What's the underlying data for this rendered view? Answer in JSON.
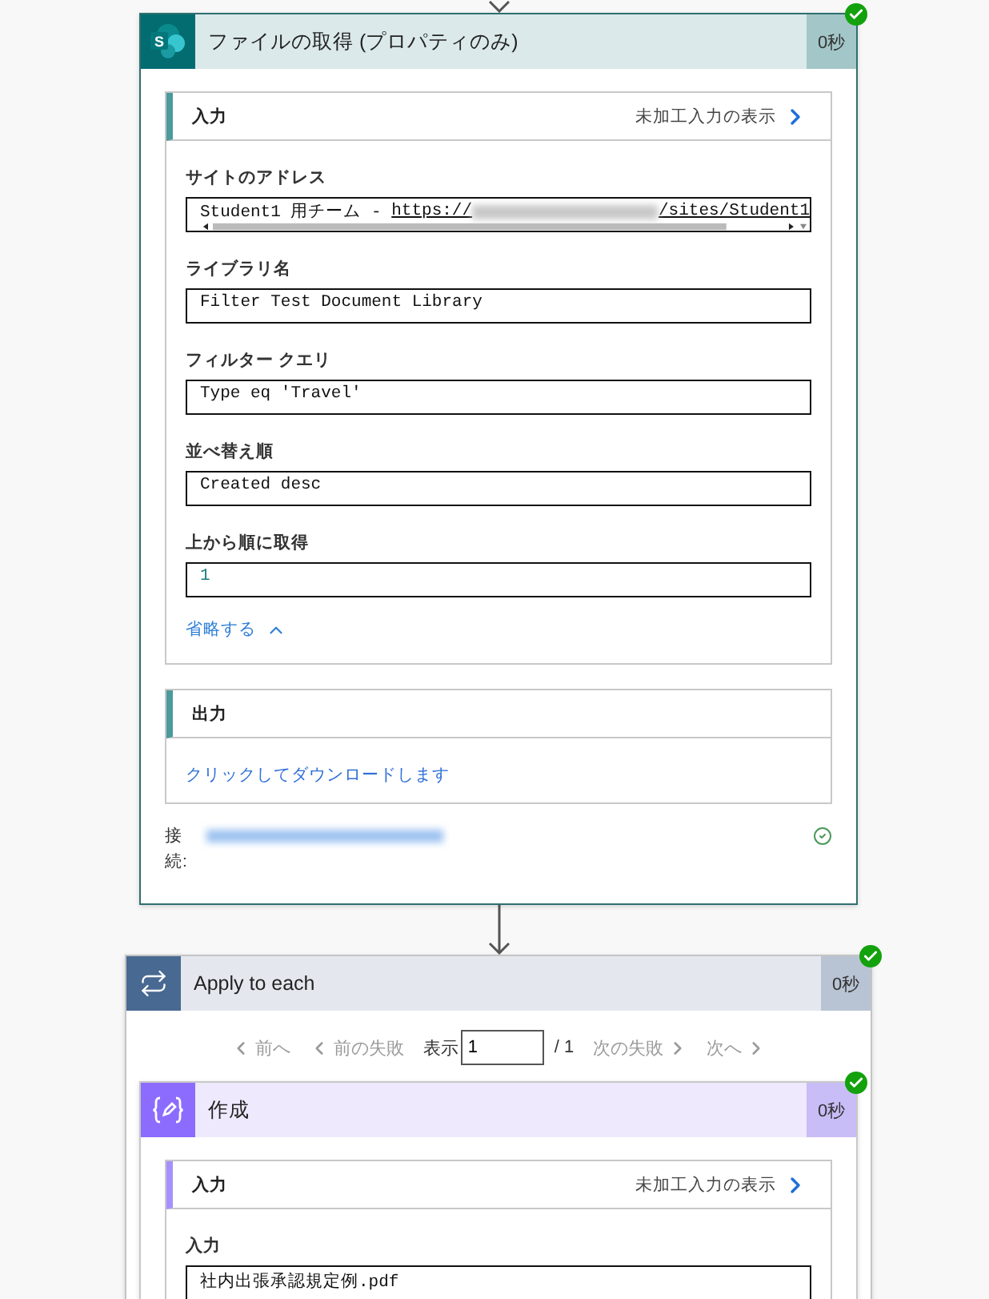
{
  "steps": [
    {
      "kind": "sharepoint",
      "logo_text": "S",
      "title": "ファイルの取得 (プロパティのみ)",
      "duration": "0秒",
      "succeeded": true,
      "inputs": {
        "heading": "入力",
        "raw_link": "未加工入力の表示",
        "collapse_link": "省略する",
        "fields": [
          {
            "label": "サイトのアドレス",
            "scrollable": true,
            "segments": [
              {
                "kind": "text",
                "text": "Student1 用チーム - "
              },
              {
                "kind": "link",
                "text": "https://"
              },
              {
                "kind": "redacted"
              },
              {
                "kind": "link",
                "text": "/sites/Student1"
              }
            ]
          },
          {
            "label": "ライブラリ名",
            "scrollable": false,
            "segments": [
              {
                "kind": "text",
                "text": "Filter Test Document Library"
              }
            ]
          },
          {
            "label": "フィルター クエリ",
            "scrollable": false,
            "segments": [
              {
                "kind": "text",
                "text": "Type eq 'Travel'"
              }
            ]
          },
          {
            "label": "並べ替え順",
            "scrollable": false,
            "segments": [
              {
                "kind": "text",
                "text": "Created desc"
              }
            ]
          },
          {
            "label": "上から順に取得",
            "scrollable": false,
            "segments": [
              {
                "kind": "number",
                "text": "1"
              }
            ]
          }
        ]
      },
      "outputs": {
        "heading": "出力",
        "download_link": "クリックしてダウンロードします"
      },
      "connection": {
        "label": "接続:",
        "account": {
          "kind": "redacted"
        },
        "valid": true
      }
    },
    {
      "kind": "loop",
      "title": "Apply to each",
      "duration": "0秒",
      "succeeded": true,
      "pager": {
        "prev": {
          "label": "前へ",
          "disabled": true
        },
        "prev_failure": {
          "label": "前の失敗",
          "disabled": true
        },
        "show_label": "表示",
        "page": "1",
        "total": "/ 1",
        "next_failure": {
          "label": "次の失敗",
          "disabled": true
        },
        "next": {
          "label": "次へ",
          "disabled": true
        }
      },
      "children": [
        {
          "kind": "compose",
          "title": "作成",
          "duration": "0秒",
          "succeeded": true,
          "inputs": {
            "heading": "入力",
            "raw_link": "未加工入力の表示",
            "fields": [
              {
                "label": "入力",
                "scrollable": false,
                "segments": [
                  {
                    "kind": "text",
                    "text": "社内出張承認規定例.pdf"
                  }
                ]
              }
            ]
          }
        }
      ]
    }
  ]
}
